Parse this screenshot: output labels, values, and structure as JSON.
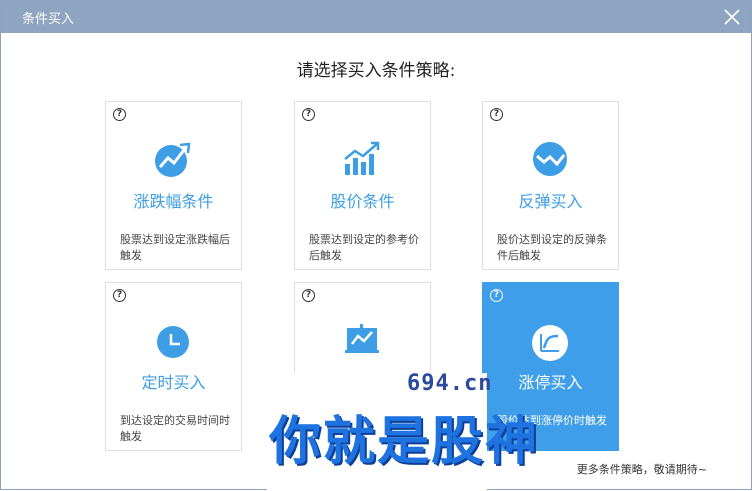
{
  "window": {
    "title": "条件买入",
    "close_icon": "close-icon"
  },
  "heading": "请选择买入条件策略:",
  "cards": [
    {
      "label": "涨跌幅条件",
      "desc": "股票达到设定涨跌幅后触发",
      "help": "?",
      "icon": "chart-up-circle-icon"
    },
    {
      "label": "股价条件",
      "desc": "股票达到设定的参考价后触发",
      "help": "?",
      "icon": "bar-chart-icon"
    },
    {
      "label": "反弹买入",
      "desc": "股价达到设定的反弹条件后触发",
      "help": "?",
      "icon": "rebound-circle-icon"
    },
    {
      "label": "定时买入",
      "desc": "到达设定的交易时间时触发",
      "help": "?",
      "icon": "clock-icon"
    },
    {
      "label": "",
      "desc": "",
      "help": "?",
      "icon": "presentation-chart-icon"
    },
    {
      "label": "涨停买入",
      "desc": "股价达到涨停价时触发",
      "help": "?",
      "icon": "limit-up-icon"
    }
  ],
  "more_text": "更多条件策略，敬请期待~",
  "watermark": {
    "domain": "694.cn",
    "text": "你就是股神"
  },
  "colors": {
    "accent": "#3e9eea",
    "titlebar": "#8ea5c1"
  }
}
